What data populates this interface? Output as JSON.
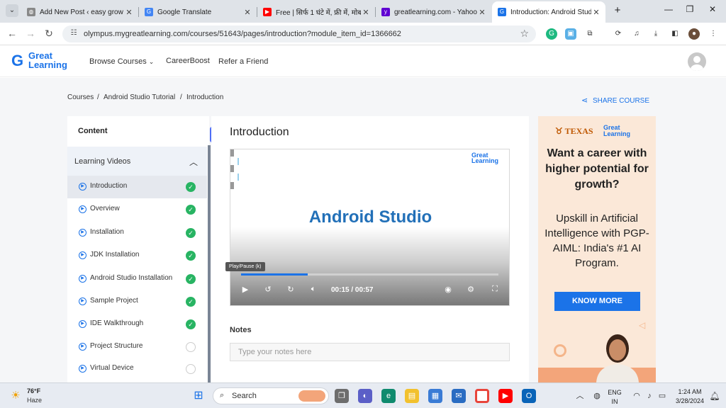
{
  "browser": {
    "tabs": [
      {
        "title": "Add New Post ‹ easy grow",
        "icon": "globe-icon"
      },
      {
        "title": "Google Translate",
        "icon": "translate-icon"
      },
      {
        "title": "Free | सिर्फ 1 घंटे में, फ्री में, मोब",
        "icon": "youtube-icon"
      },
      {
        "title": "greatlearning.com - Yahoo",
        "icon": "yahoo-icon"
      },
      {
        "title": "Introduction: Android Studi",
        "icon": "great-learning-icon"
      }
    ],
    "new_tab": "+",
    "url": "olympus.mygreatlearning.com/courses/51643/pages/introduction?module_item_id=1366662"
  },
  "site": {
    "logo_line1": "Great",
    "logo_line2": "Learning",
    "nav": {
      "browse": "Browse Courses",
      "careerboost": "CareerBoost",
      "refer": "Refer a Friend"
    }
  },
  "breadcrumb": {
    "items": [
      "Courses",
      "Android Studio Tutorial",
      "Introduction"
    ],
    "separator": "/"
  },
  "share_label": "SHARE COURSE",
  "sidebar": {
    "title": "Content",
    "section": "Learning Videos",
    "items": [
      {
        "label": "Introduction",
        "completed": true,
        "active": true
      },
      {
        "label": "Overview",
        "completed": true
      },
      {
        "label": "Installation",
        "completed": true
      },
      {
        "label": "JDK Installation",
        "completed": true
      },
      {
        "label": "Android Studio Installation",
        "completed": true
      },
      {
        "label": "Sample Project",
        "completed": true
      },
      {
        "label": "IDE Walkthrough",
        "completed": true
      },
      {
        "label": "Project Structure",
        "completed": false
      },
      {
        "label": "Virtual Device",
        "completed": false
      }
    ]
  },
  "main": {
    "title": "Introduction",
    "video": {
      "title": "Android Studio",
      "logo_line1": "Great",
      "logo_line2": "Learning",
      "tooltip": "Play/Pause (k)",
      "time": "00:15 / 00:57",
      "progress_fraction": 0.26
    },
    "notes": {
      "title": "Notes",
      "placeholder": "Type your notes here"
    }
  },
  "ad": {
    "university": "TEXAS",
    "logo_line1": "Great",
    "logo_line2": "Learning",
    "headline": "Want a career with higher potential for growth?",
    "sub": "Upskill in Artificial Intelligence with PGP-AIML: India's #1 AI Program.",
    "cta": "KNOW MORE"
  },
  "taskbar": {
    "weather_temp": "76°F",
    "weather_desc": "Haze",
    "search": "Search",
    "lang1": "ENG",
    "lang2": "IN",
    "time": "1:24 AM",
    "date": "3/28/2024"
  },
  "colors": {
    "brand_blue": "#1b73e8",
    "complete_green": "#28b463",
    "ad_bg": "#fbe8d8"
  }
}
